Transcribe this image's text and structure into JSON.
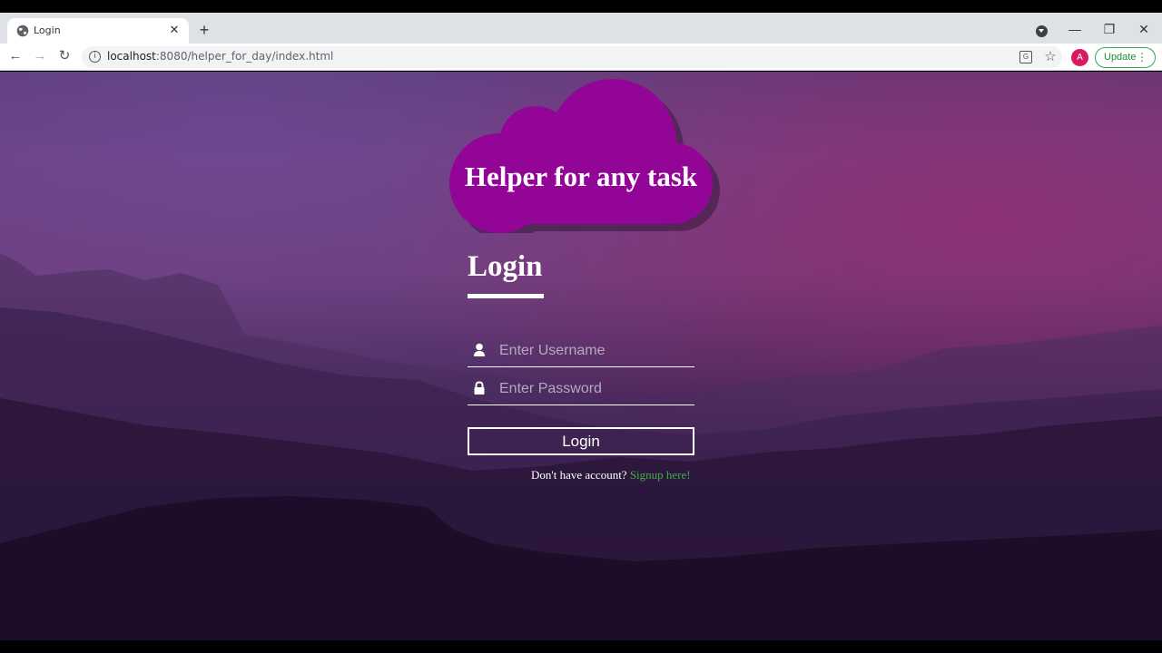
{
  "browser": {
    "tab_title": "Login",
    "new_tab": "+",
    "close_tab": "✕",
    "url_host": "localhost",
    "url_path": ":8080/helper_for_day/index.html",
    "avatar_letter": "A",
    "update_label": "Update",
    "window_controls": [
      "—",
      "❐",
      "✕"
    ]
  },
  "page": {
    "brand": "Helper for any task",
    "login_heading": "Login",
    "username_placeholder": "Enter Username",
    "password_placeholder": "Enter Password",
    "login_button": "Login",
    "signup_prompt": "Don't have account? ",
    "signup_link": "Signup here!"
  },
  "colors": {
    "cloud": "#930597",
    "signup_link": "#3cb043",
    "update_border": "#34a853"
  }
}
